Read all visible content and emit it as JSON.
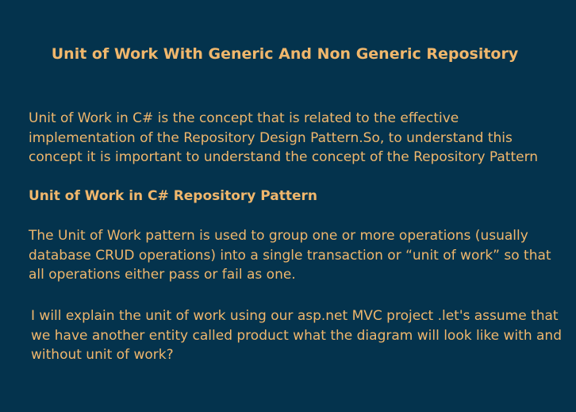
{
  "title": "Unit of Work With Generic And Non Generic Repository",
  "intro": "Unit of Work in C# is the concept that is related to the effective implementation of the Repository Design Pattern.So, to understand this concept it is important to understand the concept of the Repository Pattern",
  "section_heading": "Unit of Work in C# Repository Pattern",
  "section_paragraph": "The Unit of Work pattern is used to group one or more operations (usually database CRUD operations) into a single transaction or “unit of work” so that all operations either pass or fail as one.",
  "explanation": "I will explain the unit of work using our asp.net MVC project .let's assume that we have another entity called product what the diagram will look like with and without unit of work?",
  "colors": {
    "background": "#04334d",
    "text": "#f0b76c"
  }
}
